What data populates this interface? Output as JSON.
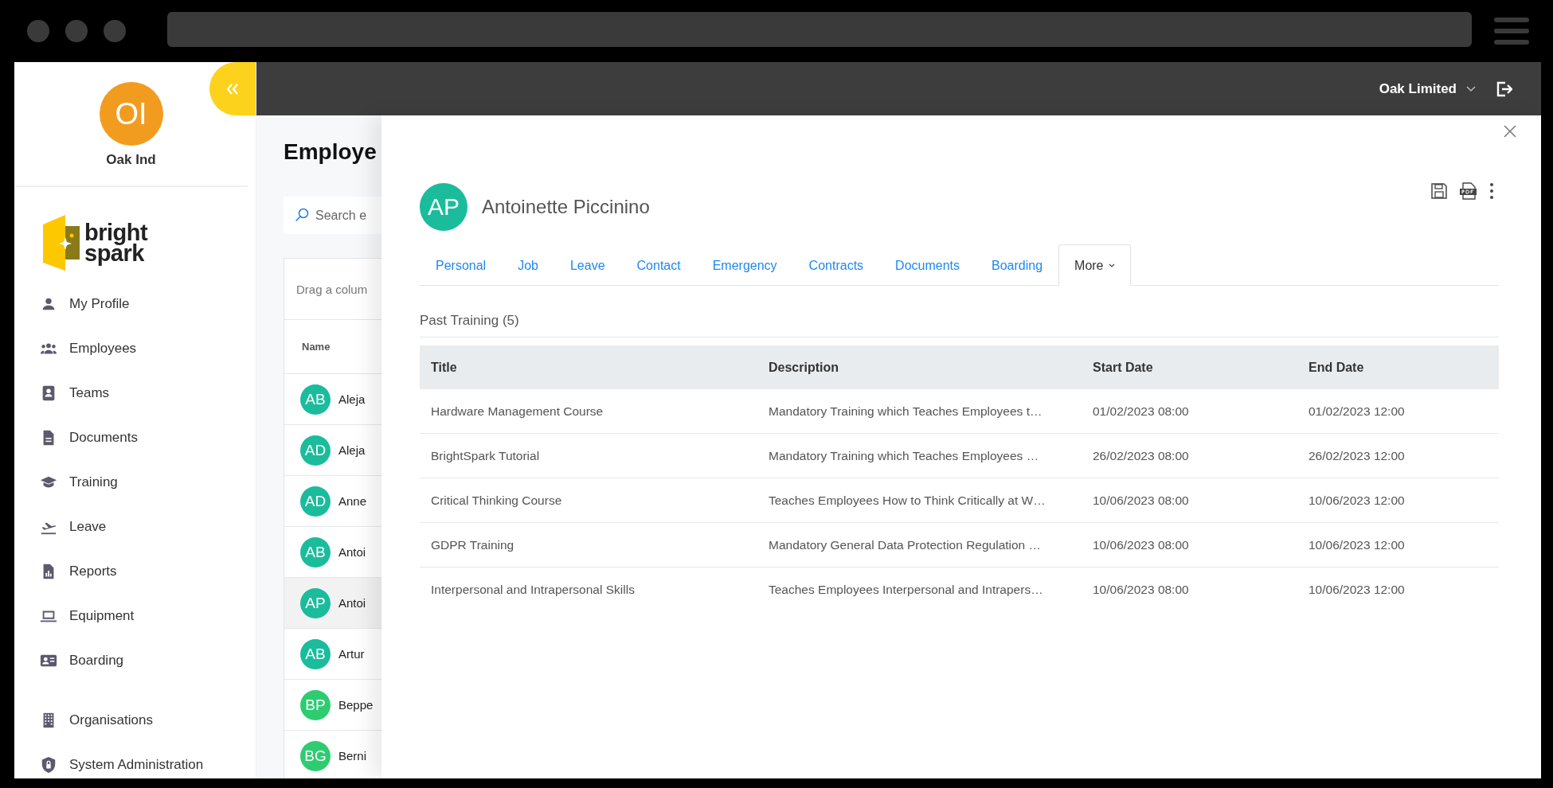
{
  "org": {
    "initials": "OI",
    "name": "Oak Ind"
  },
  "logo": {
    "line1": "bright",
    "line2": "spark"
  },
  "nav_groups": [
    {
      "items": [
        {
          "label": "My Profile"
        },
        {
          "label": "Employees"
        },
        {
          "label": "Teams"
        },
        {
          "label": "Documents"
        },
        {
          "label": "Training"
        },
        {
          "label": "Leave"
        },
        {
          "label": "Reports"
        },
        {
          "label": "Equipment"
        },
        {
          "label": "Boarding"
        }
      ]
    },
    {
      "items": [
        {
          "label": "Organisations"
        },
        {
          "label": "System Administration"
        }
      ]
    }
  ],
  "topbar": {
    "organisation": "Oak Limited"
  },
  "employees": {
    "title": "Employe",
    "search_placeholder": "Search e",
    "group_hint": "Drag a colum",
    "column": "Name",
    "rows": [
      {
        "initials": "AB",
        "name": "Aleja",
        "color": "#1abc9c",
        "selected": false
      },
      {
        "initials": "AD",
        "name": "Aleja",
        "color": "#1abc9c",
        "selected": false
      },
      {
        "initials": "AD",
        "name": "Anne",
        "color": "#1abc9c",
        "selected": false
      },
      {
        "initials": "AB",
        "name": "Antoi",
        "color": "#1abc9c",
        "selected": false
      },
      {
        "initials": "AP",
        "name": "Antoi",
        "color": "#1abc9c",
        "selected": true
      },
      {
        "initials": "AB",
        "name": "Artur",
        "color": "#1abc9c",
        "selected": false
      },
      {
        "initials": "BP",
        "name": "Beppe",
        "color": "#2ecc71",
        "selected": false
      },
      {
        "initials": "BG",
        "name": "Berni",
        "color": "#2ecc71",
        "selected": false
      }
    ]
  },
  "panel": {
    "employee": {
      "initials": "AP",
      "name": "Antoinette Piccinino"
    },
    "tabs": [
      {
        "label": "Personal",
        "kind": "link",
        "selected": false
      },
      {
        "label": "Job",
        "kind": "link",
        "selected": false
      },
      {
        "label": "Leave",
        "kind": "link",
        "selected": false
      },
      {
        "label": "Contact",
        "kind": "link",
        "selected": false
      },
      {
        "label": "Emergency",
        "kind": "link",
        "selected": false
      },
      {
        "label": "Contracts",
        "kind": "link",
        "selected": false
      },
      {
        "label": "Documents",
        "kind": "link",
        "selected": false
      },
      {
        "label": "Boarding",
        "kind": "link",
        "selected": false
      },
      {
        "label": "More",
        "kind": "menu",
        "selected": true
      }
    ],
    "section_title": "Past Training (5)",
    "table": {
      "columns": [
        "Title",
        "Description",
        "Start Date",
        "End Date"
      ],
      "rows": [
        [
          "Hardware Management Course",
          "Mandatory Training which Teaches Employees t…",
          "01/02/2023 08:00",
          "01/02/2023 12:00"
        ],
        [
          "BrightSpark Tutorial",
          "Mandatory Training which Teaches Employees …",
          "26/02/2023 08:00",
          "26/02/2023 12:00"
        ],
        [
          "Critical Thinking Course",
          "Teaches Employees How to Think Critically at W…",
          "10/06/2023 08:00",
          "10/06/2023 12:00"
        ],
        [
          "GDPR Training",
          "Mandatory General Data Protection Regulation …",
          "10/06/2023 08:00",
          "10/06/2023 12:00"
        ],
        [
          "Interpersonal and Intrapersonal Skills",
          "Teaches Employees Interpersonal and Intrapers…",
          "10/06/2023 08:00",
          "10/06/2023 12:00"
        ]
      ]
    }
  }
}
